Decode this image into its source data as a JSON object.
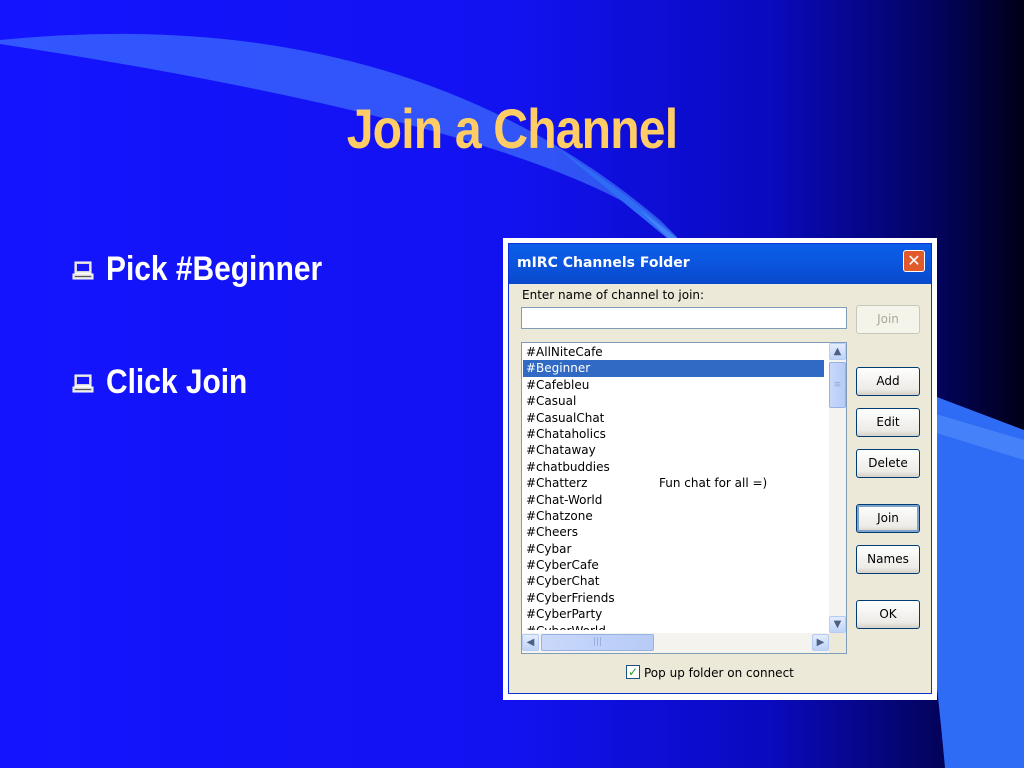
{
  "slide": {
    "title": "Join a Channel",
    "bullets": [
      {
        "text": "Pick #Beginner",
        "icon": "computer-icon"
      },
      {
        "text": "Click Join",
        "icon": "computer-icon"
      }
    ],
    "colors": {
      "title": "#ffcc66",
      "background": "#1414ff",
      "bullet_text": "#ffffff"
    }
  },
  "dialog": {
    "title": "mIRC Channels Folder",
    "close_glyph": "✕",
    "prompt_label": "Enter name of channel to join:",
    "channel_input_value": "",
    "buttons": {
      "join_top": "Join",
      "add": "Add",
      "edit": "Edit",
      "delete": "Delete",
      "join": "Join",
      "names": "Names",
      "ok": "OK"
    },
    "channels": [
      {
        "name": "#AllNiteCafe",
        "desc": ""
      },
      {
        "name": "#Beginner",
        "desc": ""
      },
      {
        "name": "#Cafebleu",
        "desc": ""
      },
      {
        "name": "#Casual",
        "desc": ""
      },
      {
        "name": "#CasualChat",
        "desc": ""
      },
      {
        "name": "#Chataholics",
        "desc": ""
      },
      {
        "name": "#Chataway",
        "desc": ""
      },
      {
        "name": "#chatbuddies",
        "desc": ""
      },
      {
        "name": "#Chatterz",
        "desc": "Fun chat for all =)"
      },
      {
        "name": "#Chat-World",
        "desc": ""
      },
      {
        "name": "#Chatzone",
        "desc": ""
      },
      {
        "name": "#Cheers",
        "desc": ""
      },
      {
        "name": "#Cybar",
        "desc": ""
      },
      {
        "name": "#CyberCafe",
        "desc": ""
      },
      {
        "name": "#CyberChat",
        "desc": ""
      },
      {
        "name": "#CyberFriends",
        "desc": ""
      },
      {
        "name": "#CyberParty",
        "desc": ""
      },
      {
        "name": "#CyberWorld",
        "desc": ""
      }
    ],
    "selected_index": 1,
    "checkbox": {
      "label": "Pop up folder on connect",
      "checked": true,
      "mark": "✓"
    },
    "scroll_glyphs": {
      "up": "▲",
      "down": "▼",
      "left": "◀",
      "right": "▶",
      "grip_v": "≡",
      "grip_h": "|||"
    }
  }
}
